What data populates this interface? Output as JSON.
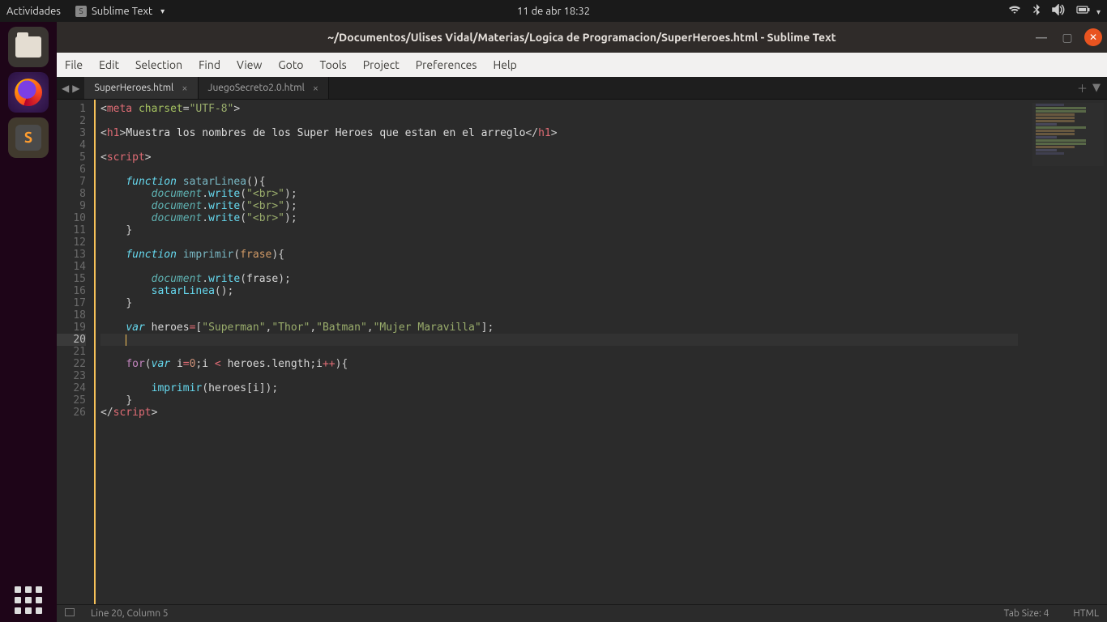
{
  "gnome": {
    "activities": "Actividades",
    "app_name": "Sublime Text",
    "datetime": "11 de abr  18:32"
  },
  "dock": {
    "items": [
      "files",
      "firefox",
      "sublime"
    ]
  },
  "window": {
    "title": "~/Documentos/Ulises Vidal/Materias/Logica de Programacion/SuperHeroes.html - Sublime Text"
  },
  "menu": {
    "items": [
      "File",
      "Edit",
      "Selection",
      "Find",
      "View",
      "Goto",
      "Tools",
      "Project",
      "Preferences",
      "Help"
    ]
  },
  "tabs": [
    {
      "label": "SuperHeroes.html",
      "active": true
    },
    {
      "label": "JuegoSecreto2.0.html",
      "active": false
    }
  ],
  "editor": {
    "line_count": 26,
    "highlighted_line": 20,
    "cursor_line": 20,
    "cursor_col": 5,
    "h1_text": "Muestra los nombres de los Super Heroes que estan en el arreglo",
    "heroes": [
      "Superman",
      "Thor",
      "Batman",
      "Mujer Maravilla"
    ],
    "br_literal": "\"<br>\"",
    "functions": {
      "satarLinea": "satarLinea",
      "imprimir": "imprimir",
      "param_frase": "frase"
    }
  },
  "status": {
    "position": "Line 20, Column 5",
    "tab_size": "Tab Size: 4",
    "syntax": "HTML"
  }
}
